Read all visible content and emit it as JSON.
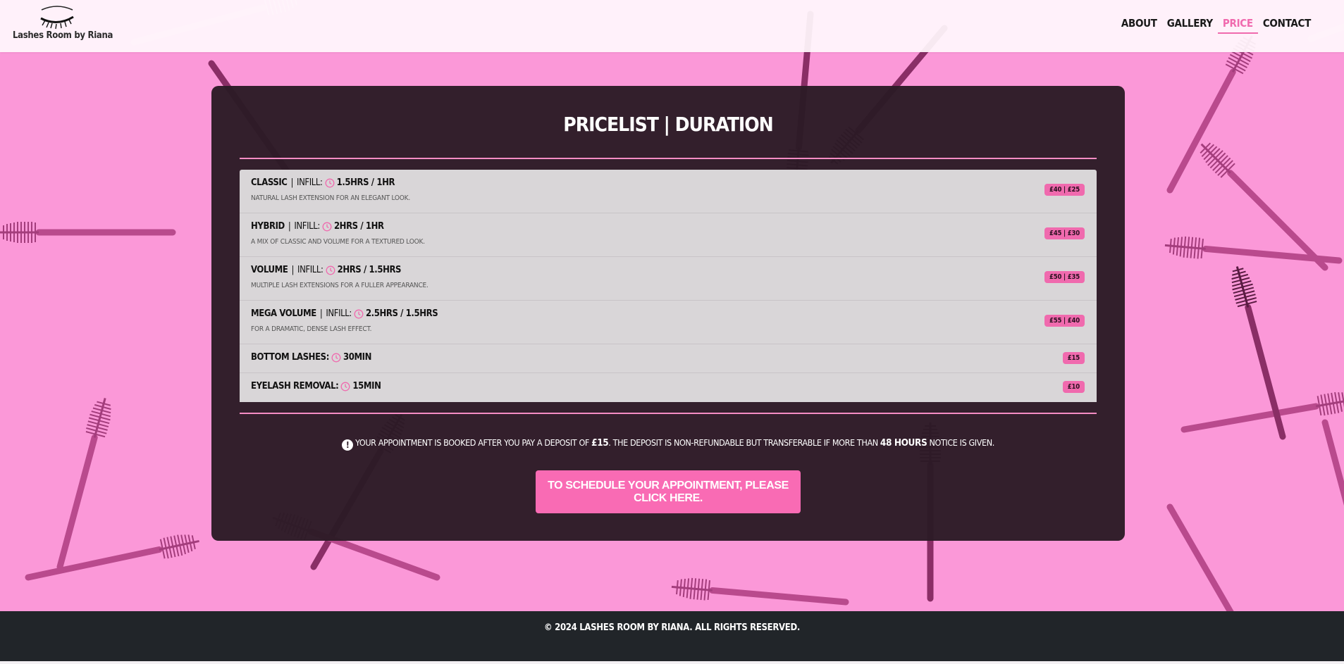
{
  "brand": {
    "name": "Lashes Room by Riana",
    "accent_color": "#f06aae",
    "background_color": "#fb98d8",
    "card_color": "#2c1b26",
    "footer_color": "#212529"
  },
  "nav": {
    "items": [
      {
        "label": "ABOUT",
        "active": false
      },
      {
        "label": "GALLERY",
        "active": false
      },
      {
        "label": "PRICE",
        "active": true
      },
      {
        "label": "CONTACT",
        "active": false
      }
    ]
  },
  "pricelist": {
    "title": "PRICELIST | DURATION",
    "items": [
      {
        "name": "CLASSIC",
        "infill_label": "INFILL:",
        "icon": "clock-icon",
        "duration": "1.5HRS / 1HR",
        "description": "NATURAL LASH EXTENSION FOR AN ELEGANT LOOK.",
        "price": "£40 | £25"
      },
      {
        "name": "HYBRID",
        "infill_label": "INFILL:",
        "icon": "clock-icon",
        "duration": "2HRS / 1HR",
        "description": "A MIX OF CLASSIC AND VOLUME FOR A TEXTURED LOOK.",
        "price": "£45 | £30"
      },
      {
        "name": "VOLUME",
        "infill_label": "INFILL:",
        "icon": "clock-icon",
        "duration": "2HRS / 1.5HRS",
        "description": "MULTIPLE LASH EXTENSIONS FOR A FULLER APPEARANCE.",
        "price": "£50 | £35"
      },
      {
        "name": "MEGA VOLUME",
        "infill_label": "INFILL:",
        "icon": "clock-icon",
        "duration": "2.5HRS / 1.5HRS",
        "description": "FOR A DRAMATIC, DENSE LASH EFFECT.",
        "price": "£55 | £40"
      },
      {
        "name": "BOTTOM LASHES:",
        "icon": "clock-icon",
        "duration": "30MIN",
        "price": "£15"
      },
      {
        "name": "EYELASH REMOVAL:",
        "icon": "clock-icon",
        "duration": "15MIN",
        "price": "£10"
      }
    ]
  },
  "notice": {
    "icon": "exclamation-circle-icon",
    "text_1": "YOUR APPOINTMENT IS BOOKED AFTER YOU PAY A DEPOSIT OF ",
    "deposit": "£15",
    "text_2": ". THE DEPOSIT IS NON-REFUNDABLE BUT TRANSFERABLE IF MORE THAN ",
    "hours": "48 HOURS",
    "text_3": " NOTICE IS GIVEN."
  },
  "cta": {
    "label": "TO SCHEDULE YOUR APPOINTMENT, PLEASE CLICK HERE."
  },
  "footer": {
    "text": "© 2024 LASHES ROOM BY RIANA. ALL RIGHTS RESERVED."
  }
}
